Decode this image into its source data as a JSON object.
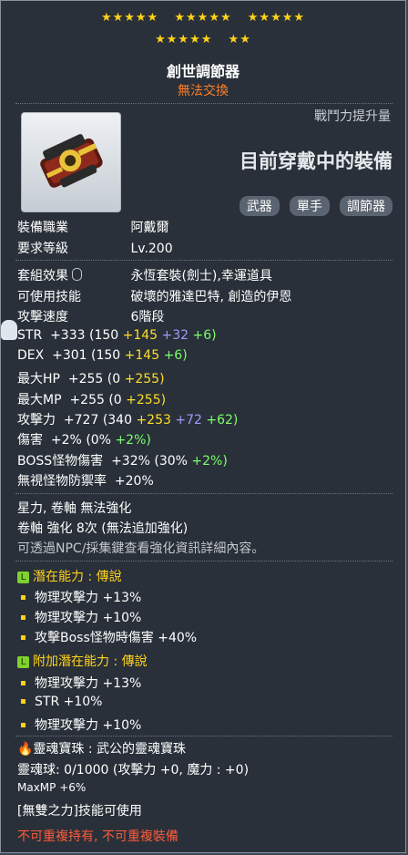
{
  "stars": {
    "row1": [
      "★★★★★",
      "★★★★★",
      "★★★★★"
    ],
    "row2": [
      "★★★★★",
      "★★"
    ]
  },
  "item": {
    "name": "創世調節器",
    "trade": "無法交換"
  },
  "panel": {
    "power_label": "戰鬥力提升量",
    "wearing": "目前穿戴中的裝備",
    "tags": [
      "武器",
      "單手",
      "調節器"
    ]
  },
  "req": {
    "job_label": "裝備職業",
    "job_value": "阿戴爾",
    "level_label": "要求等級",
    "level_value": "Lv.200"
  },
  "info": {
    "set_label": "套組效果",
    "set_value": "永恆套裝(劍士),幸運道具",
    "skill_label": "可使用技能",
    "skill_value": "破壞的雅達巴特, 創造的伊恩",
    "speed_label": "攻擊速度",
    "speed_value": "6階段"
  },
  "stats": [
    {
      "label": "STR",
      "total": "+333",
      "base": "(150",
      "s1": "+145",
      "s2": "+32",
      "s3": "+6)"
    },
    {
      "label": "DEX",
      "total": "+301",
      "base": "(150",
      "s1": "+145",
      "s2": "",
      "s3": "+6)"
    },
    {
      "label": "最大HP",
      "total": "+255",
      "base": "(0",
      "s1": "+255)",
      "s2": "",
      "s3": ""
    },
    {
      "label": "最大MP",
      "total": "+255",
      "base": "(0",
      "s1": "+255)",
      "s2": "",
      "s3": ""
    },
    {
      "label": "攻擊力",
      "total": "+727",
      "base": "(340",
      "s1": "+253",
      "s2": "+72",
      "s3": "+62)"
    },
    {
      "label": "傷害",
      "total": "+2%",
      "base": "(0%",
      "s1": "",
      "s2": "",
      "s3": "+2%)"
    },
    {
      "label": "BOSS怪物傷害",
      "total": "+32%",
      "base": "(30%",
      "s1": "",
      "s2": "",
      "s3": "+2%)"
    },
    {
      "label": "無視怪物防禦率",
      "total": "+20%",
      "base": "",
      "s1": "",
      "s2": "",
      "s3": ""
    }
  ],
  "enhance": {
    "line1": "星力, 卷軸 無法強化",
    "line2": "卷軸 強化 8次 (無法追加強化)",
    "line3": "可透過NPC/採集鍵查看強化資訊詳細內容。"
  },
  "potential": {
    "title": "潛在能力 : 傳說",
    "lines": [
      "物理攻擊力 +13%",
      "物理攻擊力 +10%",
      "攻擊Boss怪物時傷害 +40%"
    ]
  },
  "bonus_potential": {
    "title": "附加潛在能力 : 傳說",
    "lines": [
      "物理攻擊力 +13%",
      "STR +10%",
      "物理攻擊力 +10%"
    ]
  },
  "soul": {
    "title": "靈魂寶珠 : 武公的靈魂寶珠",
    "orb": "靈魂球: 0/1000 (攻擊力 +0, 魔力 : +0)",
    "mp": "MaxMP +6%",
    "skill": "[無雙之力]技能可使用"
  },
  "warning": "不可重複持有, 不可重複裝備",
  "colors": {
    "star": "#ffd21a",
    "trade": "#ff7f2a",
    "warning": "#ff5a3a",
    "potential_badge": "#7fd12b"
  }
}
